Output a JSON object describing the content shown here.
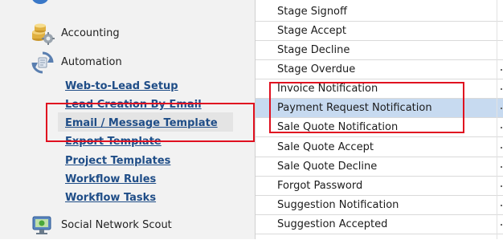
{
  "nav": {
    "categories": [
      {
        "name": "accounting",
        "label": "Accounting",
        "icon": "accounting-icon"
      },
      {
        "name": "automation",
        "label": "Automation",
        "icon": "automation-refresh-icon"
      },
      {
        "name": "social",
        "label": "Social Network Scout",
        "icon": "social-network-icon"
      }
    ],
    "automation_items": [
      {
        "label": "Web-to-Lead Setup"
      },
      {
        "label": "Lead Creation By Email"
      },
      {
        "label": "Email / Message Template",
        "selected": true
      },
      {
        "label": "Export Template"
      },
      {
        "label": "Project Templates"
      },
      {
        "label": "Workflow Rules"
      },
      {
        "label": "Workflow Tasks"
      }
    ]
  },
  "template_list": {
    "items": [
      {
        "label": "Stage Signoff"
      },
      {
        "label": "Stage Accept"
      },
      {
        "label": "Stage Decline"
      },
      {
        "label": "Stage Overdue"
      },
      {
        "label": "Invoice Notification"
      },
      {
        "label": "Payment Request Notification",
        "selected": true
      },
      {
        "label": "Sale Quote Notification"
      },
      {
        "label": "Sale Quote Accept"
      },
      {
        "label": "Sale Quote Decline"
      },
      {
        "label": "Forgot Password"
      },
      {
        "label": "Suggestion Notification"
      },
      {
        "label": "Suggestion Accepted"
      }
    ]
  },
  "colors": {
    "nav_link": "#1f4d87",
    "row_selected": "#c7daf0",
    "annotation_box": "#e01020",
    "left_panel_bg": "#f2f2f2"
  }
}
